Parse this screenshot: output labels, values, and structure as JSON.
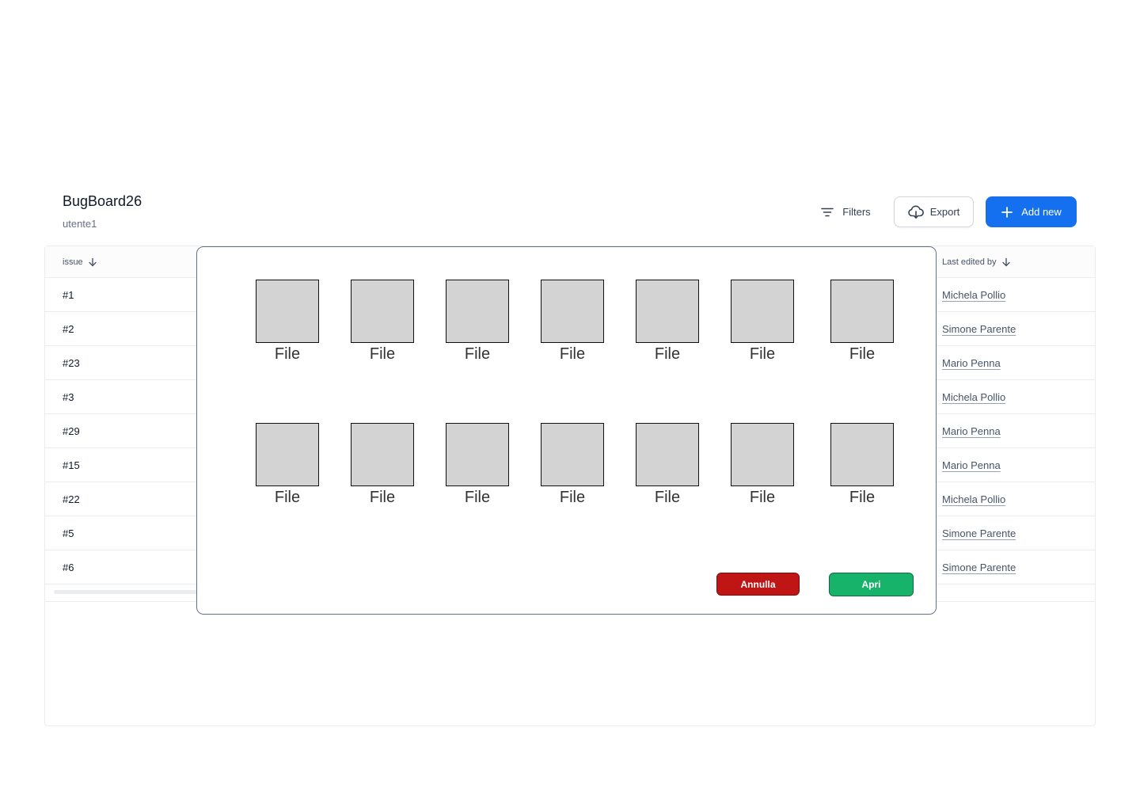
{
  "header": {
    "title": "BugBoard26",
    "subtitle": "utente1",
    "filters_label": "Filters",
    "export_label": "Export",
    "add_new_label": "Add new"
  },
  "table": {
    "columns": {
      "issue": "issue",
      "last_edited_by": "Last edited by"
    },
    "rows": [
      {
        "issue": "#1",
        "editor": "Michela Pollio"
      },
      {
        "issue": "#2",
        "editor": "Simone Parente"
      },
      {
        "issue": "#23",
        "editor": "Mario Penna"
      },
      {
        "issue": "#3",
        "editor": "Michela Pollio"
      },
      {
        "issue": "#29",
        "editor": "Mario Penna"
      },
      {
        "issue": "#15",
        "editor": "Mario Penna"
      },
      {
        "issue": "#22",
        "editor": "Michela Pollio"
      },
      {
        "issue": "#5",
        "editor": "Simone Parente"
      },
      {
        "issue": "#6",
        "editor": "Simone Parente"
      }
    ]
  },
  "modal": {
    "files": [
      "File",
      "File",
      "File",
      "File",
      "File",
      "File",
      "File",
      "File",
      "File",
      "File",
      "File",
      "File",
      "File",
      "File"
    ],
    "cancel_label": "Annulla",
    "open_label": "Apri"
  },
  "colors": {
    "primary": "#1570ef",
    "cancel": "#c01515",
    "open": "#17b36a",
    "file_thumb": "#d3d3d3"
  },
  "icons": {
    "filters": "filter-lines-icon",
    "export": "cloud-download-icon",
    "add": "plus-icon",
    "sort": "arrow-down-icon"
  }
}
